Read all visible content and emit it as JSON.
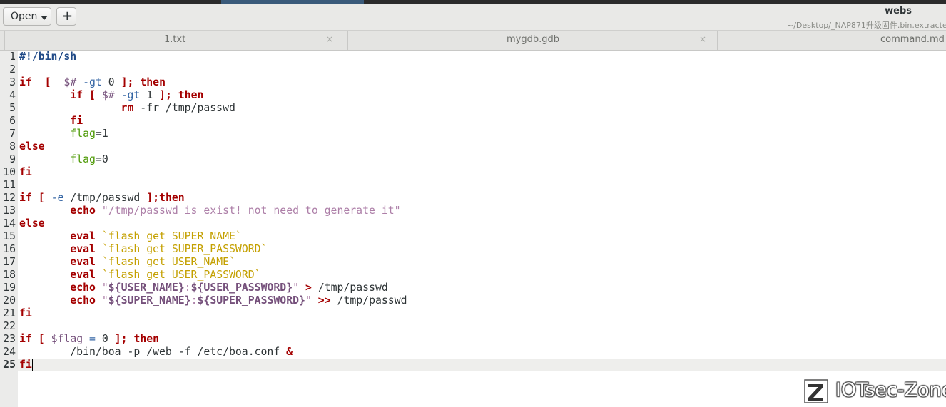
{
  "header": {
    "open_label": "Open",
    "new_label": "+",
    "title": "webs",
    "subtitle": "~/Desktop/_NAP871升级固件.bin.extracte"
  },
  "tabs": [
    {
      "label": "1.txt",
      "close": "×"
    },
    {
      "label": "mygdb.gdb",
      "close": "×"
    },
    {
      "label": "command.md",
      "close": ""
    }
  ],
  "editor": {
    "current_line": 25,
    "lines": [
      {
        "n": 1,
        "segs": [
          [
            "shebang",
            "#!/bin/sh"
          ]
        ]
      },
      {
        "n": 2,
        "segs": []
      },
      {
        "n": 3,
        "segs": [
          [
            "kw",
            "if"
          ],
          [
            "",
            "  "
          ],
          [
            "kw",
            "["
          ],
          [
            "",
            ""
          ],
          [
            "",
            ""
          ],
          [
            "",
            "  "
          ],
          [
            "var",
            "$#"
          ],
          [
            "",
            ""
          ],
          [
            "op",
            " -gt"
          ],
          [
            "",
            " 0 "
          ],
          [
            "kw",
            "];"
          ],
          [
            "",
            " "
          ],
          [
            "kw",
            "then"
          ]
        ]
      },
      {
        "n": 4,
        "segs": [
          [
            "",
            "        "
          ],
          [
            "kw",
            "if"
          ],
          [
            "",
            " "
          ],
          [
            "kw",
            "["
          ],
          [
            "",
            " "
          ],
          [
            "var",
            "$#"
          ],
          [
            "op",
            " -gt"
          ],
          [
            "",
            " 1 "
          ],
          [
            "kw",
            "];"
          ],
          [
            "",
            " "
          ],
          [
            "kw",
            "then"
          ]
        ]
      },
      {
        "n": 5,
        "segs": [
          [
            "",
            "                "
          ],
          [
            "cmd",
            "rm"
          ],
          [
            "",
            " -fr /tmp/passwd"
          ]
        ]
      },
      {
        "n": 6,
        "segs": [
          [
            "",
            "        "
          ],
          [
            "kw",
            "fi"
          ]
        ]
      },
      {
        "n": 7,
        "segs": [
          [
            "",
            "        "
          ],
          [
            "vg",
            "flag"
          ],
          [
            "",
            "=1"
          ]
        ]
      },
      {
        "n": 8,
        "segs": [
          [
            "kw",
            "else"
          ]
        ]
      },
      {
        "n": 9,
        "segs": [
          [
            "",
            "        "
          ],
          [
            "vg",
            "flag"
          ],
          [
            "",
            "=0"
          ]
        ]
      },
      {
        "n": 10,
        "segs": [
          [
            "kw",
            "fi"
          ]
        ]
      },
      {
        "n": 11,
        "segs": []
      },
      {
        "n": 12,
        "segs": [
          [
            "kw",
            "if"
          ],
          [
            "",
            " "
          ],
          [
            "kw",
            "["
          ],
          [
            "op",
            " -e"
          ],
          [
            "",
            " /tmp/passwd "
          ],
          [
            "kw",
            "];then"
          ]
        ]
      },
      {
        "n": 13,
        "segs": [
          [
            "",
            "        "
          ],
          [
            "kw",
            "echo"
          ],
          [
            "",
            " "
          ],
          [
            "str",
            "\"/tmp/passwd is exist! not need to generate it\""
          ]
        ]
      },
      {
        "n": 14,
        "segs": [
          [
            "kw",
            "else"
          ]
        ]
      },
      {
        "n": 15,
        "segs": [
          [
            "",
            "        "
          ],
          [
            "kw",
            "eval"
          ],
          [
            "",
            " "
          ],
          [
            "tk",
            "`flash get SUPER_NAME`"
          ]
        ]
      },
      {
        "n": 16,
        "segs": [
          [
            "",
            "        "
          ],
          [
            "kw",
            "eval"
          ],
          [
            "",
            " "
          ],
          [
            "tk",
            "`flash get SUPER_PASSWORD`"
          ]
        ]
      },
      {
        "n": 17,
        "segs": [
          [
            "",
            "        "
          ],
          [
            "kw",
            "eval"
          ],
          [
            "",
            " "
          ],
          [
            "tk",
            "`flash get USER_NAME`"
          ]
        ]
      },
      {
        "n": 18,
        "segs": [
          [
            "",
            "        "
          ],
          [
            "kw",
            "eval"
          ],
          [
            "",
            " "
          ],
          [
            "tk",
            "`flash get USER_PASSWORD`"
          ]
        ]
      },
      {
        "n": 19,
        "segs": [
          [
            "",
            "        "
          ],
          [
            "kw",
            "echo"
          ],
          [
            "",
            " "
          ],
          [
            "str",
            "\""
          ],
          [
            "vb",
            "${USER_NAME}"
          ],
          [
            "str",
            ":"
          ],
          [
            "vb",
            "${USER_PASSWORD}"
          ],
          [
            "str",
            "\""
          ],
          [
            "",
            " "
          ],
          [
            "kw",
            ">"
          ],
          [
            "",
            " /tmp/passwd"
          ]
        ]
      },
      {
        "n": 20,
        "segs": [
          [
            "",
            "        "
          ],
          [
            "kw",
            "echo"
          ],
          [
            "",
            " "
          ],
          [
            "str",
            "\""
          ],
          [
            "vb",
            "${SUPER_NAME}"
          ],
          [
            "str",
            ":"
          ],
          [
            "vb",
            "${SUPER_PASSWORD}"
          ],
          [
            "str",
            "\""
          ],
          [
            "",
            " "
          ],
          [
            "kw",
            ">>"
          ],
          [
            "",
            " /tmp/passwd"
          ]
        ]
      },
      {
        "n": 21,
        "segs": [
          [
            "kw",
            "fi"
          ]
        ]
      },
      {
        "n": 22,
        "segs": []
      },
      {
        "n": 23,
        "segs": [
          [
            "kw",
            "if"
          ],
          [
            "",
            " "
          ],
          [
            "kw",
            "["
          ],
          [
            "",
            " "
          ],
          [
            "var",
            "$flag"
          ],
          [
            "op",
            " ="
          ],
          [
            "",
            " 0 "
          ],
          [
            "kw",
            "];"
          ],
          [
            "",
            " "
          ],
          [
            "kw",
            "then"
          ]
        ]
      },
      {
        "n": 24,
        "segs": [
          [
            "",
            "        /bin/boa -p /web -f /etc/boa.conf "
          ],
          [
            "kw",
            "&"
          ]
        ]
      },
      {
        "n": 25,
        "segs": [
          [
            "kw",
            "fi"
          ]
        ]
      }
    ]
  },
  "watermark": {
    "text": "IOTsec-Zone"
  }
}
